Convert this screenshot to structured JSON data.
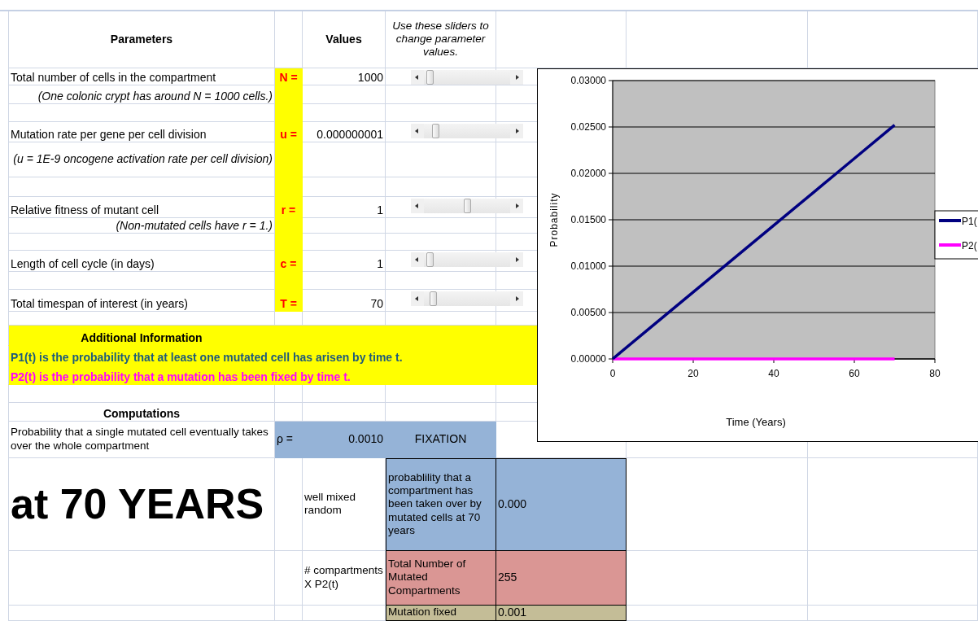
{
  "header": {
    "parameters": "Parameters",
    "values": "Values",
    "slider_hint": "Use these sliders to change  parameter values."
  },
  "parameters": [
    {
      "label": "Total number of cells in the compartment",
      "note": "(One colonic crypt has around N = 1000 cells.)",
      "symbol": "N =",
      "value": "1000",
      "slider": {
        "level": 0.03
      }
    },
    {
      "label": "Mutation rate per gene per cell division",
      "note": "(u = 1E-9 oncogene activation rate per cell division)",
      "symbol": "u =",
      "value": "0.000000001",
      "slider": {
        "level": 0.1
      }
    },
    {
      "label": "Relative fitness of mutant cell",
      "note": "(Non-mutated cells have r = 1.)",
      "symbol": "r =",
      "value": "1",
      "slider": {
        "level": 0.5
      }
    },
    {
      "label": "Length of cell cycle (in days)",
      "symbol": "c =",
      "value": "1",
      "slider": {
        "level": 0.03
      }
    },
    {
      "label": "Total timespan of interest (in years)",
      "symbol": "T =",
      "value": "70",
      "slider": {
        "level": 0.07
      }
    }
  ],
  "additional_info": {
    "title": "Additional Information",
    "lines": [
      {
        "text": "P1(t) is the probability that at least one mutated cell has arisen by time t.",
        "color": "#1f5a7a"
      },
      {
        "text": "P2(t) is the probability that a mutation has been fixed by time t.",
        "color": "#ff00ff"
      }
    ]
  },
  "computations": {
    "title": "Computations",
    "fixation": {
      "label": "Probability that a single mutated cell eventually takes over the whole compartment",
      "rho_label": "ρ =",
      "rho_value": "0.0010",
      "tag": "FIXATION"
    },
    "headline": "at 70 YEARS",
    "results": [
      {
        "method": "well mixed random",
        "description": "probablility that a compartment has been taken over by mutated cells at 70 years",
        "value": "0.000",
        "color": "#95b3d7"
      },
      {
        "method": "# compartments X P2(t)",
        "description": "Total Number of Mutated Compartments",
        "value": "255",
        "color": "#da9694"
      },
      {
        "description": "Mutation fixed",
        "value": "0.001",
        "color": "#c4bd97"
      }
    ]
  },
  "chart": {
    "chart_data": {
      "type": "line",
      "xlabel": "Time (Years)",
      "ylabel": "Probability",
      "x": [
        0,
        10,
        20,
        30,
        40,
        50,
        60,
        70
      ],
      "series": [
        {
          "name": "P1(",
          "color": "#000080",
          "values": [
            0,
            0.0036,
            0.0072,
            0.0108,
            0.0144,
            0.018,
            0.0216,
            0.0252
          ]
        },
        {
          "name": "P2(",
          "color": "#ff00ff",
          "values": [
            0,
            0,
            0,
            0,
            0,
            0,
            0,
            0
          ]
        }
      ],
      "grid": true,
      "legend": "right",
      "xlim": [
        0,
        80
      ],
      "ylim": [
        0,
        0.03
      ],
      "xticks": [
        0,
        20,
        40,
        60,
        80
      ],
      "yticks": [
        {
          "value": 0,
          "label": "0.00000"
        },
        {
          "value": 0.005,
          "label": "0.00500"
        },
        {
          "value": 0.01,
          "label": "0.01000"
        },
        {
          "value": 0.015,
          "label": "0.01500"
        },
        {
          "value": 0.02,
          "label": "0.02000"
        },
        {
          "value": 0.025,
          "label": "0.02500"
        },
        {
          "value": 0.03,
          "label": "0.03000"
        }
      ]
    }
  }
}
